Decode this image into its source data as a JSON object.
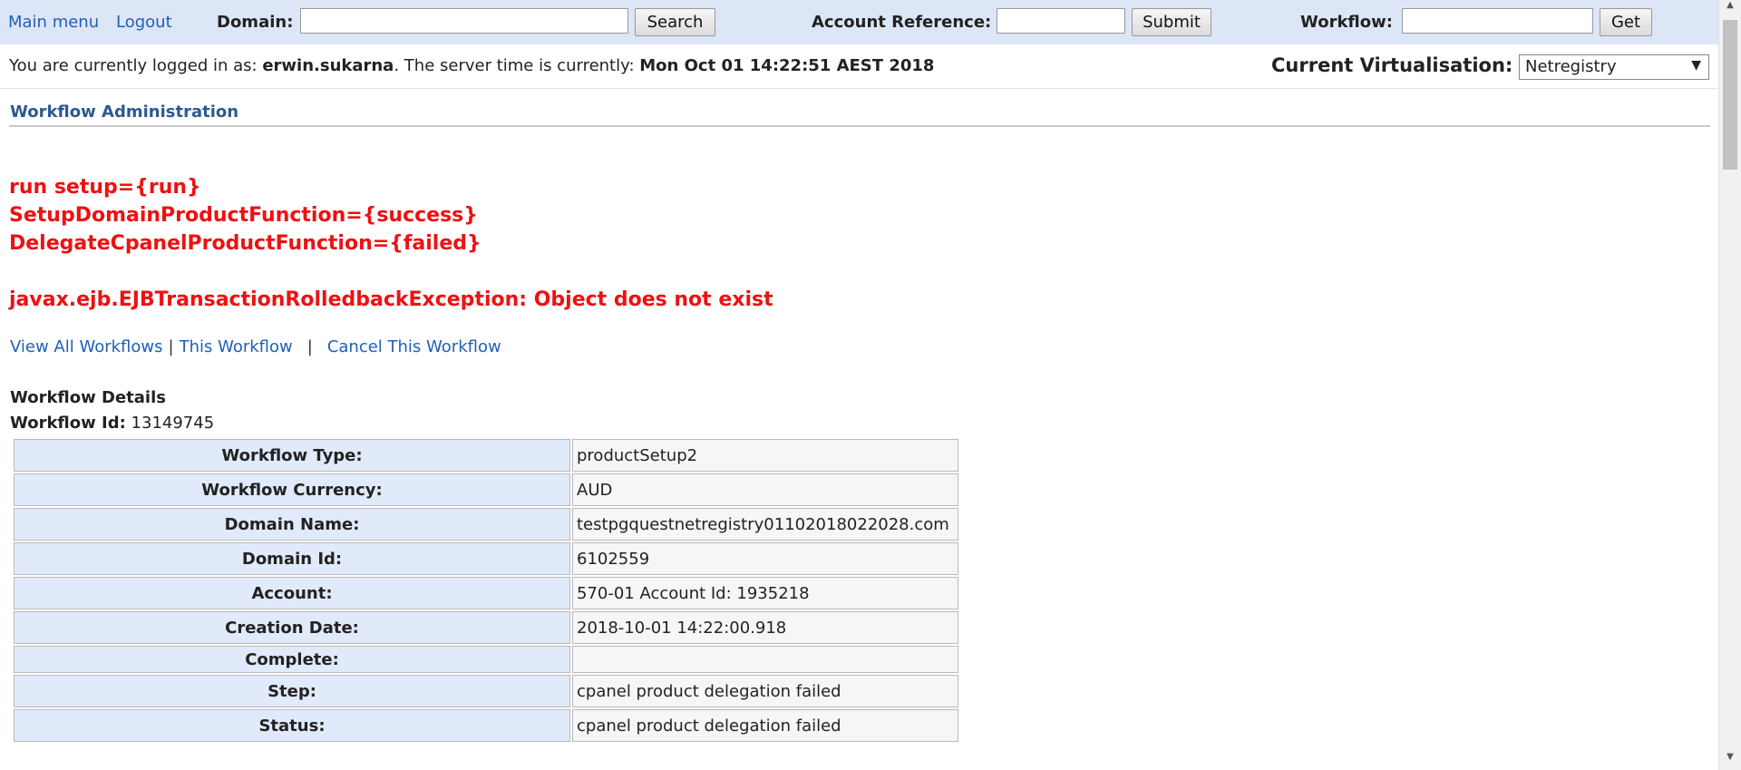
{
  "topbar": {
    "main_menu": "Main menu",
    "logout": "Logout",
    "domain_label": "Domain:",
    "domain_value": "",
    "search_button": "Search",
    "account_ref_label": "Account Reference:",
    "account_ref_value": "",
    "submit_button": "Submit",
    "workflow_label": "Workflow:",
    "workflow_value": "",
    "get_button": "Get"
  },
  "status": {
    "logged_in_prefix": "You are currently logged in as: ",
    "username": "erwin.sukarna",
    "server_time_prefix": ". The server time is currently: ",
    "server_time": "Mon Oct 01 14:22:51 AEST 2018",
    "virtualisation_label": "Current Virtualisation:",
    "virtualisation_value": "Netregistry"
  },
  "section_title": "Workflow Administration",
  "messages": [
    "run setup={run}",
    "SetupDomainProductFunction={success}",
    "DelegateCpanelProductFunction={failed}",
    "javax.ejb.EJBTransactionRolledbackException: Object does not exist"
  ],
  "links": {
    "view_all": "View All Workflows",
    "sep1": "|",
    "this_workflow": "This Workflow",
    "sep2": "|",
    "cancel": "Cancel This Workflow"
  },
  "details": {
    "title": "Workflow Details",
    "id_label": "Workflow Id:",
    "id_value": "13149745",
    "rows": [
      {
        "label": "Workflow Type:",
        "value": "productSetup2"
      },
      {
        "label": "Workflow Currency:",
        "value": "AUD"
      },
      {
        "label": "Domain Name:",
        "value": "testpgquestnetregistry01102018022028.com"
      },
      {
        "label": "Domain Id:",
        "value": "6102559"
      },
      {
        "label": "Account:",
        "value": "570-01 Account Id: 1935218"
      },
      {
        "label": "Creation Date:",
        "value": "2018-10-01 14:22:00.918"
      },
      {
        "label": "Complete:",
        "value": ""
      },
      {
        "label": "Step:",
        "value": "cpanel product delegation failed"
      },
      {
        "label": "Status:",
        "value": "cpanel product delegation failed"
      }
    ]
  }
}
